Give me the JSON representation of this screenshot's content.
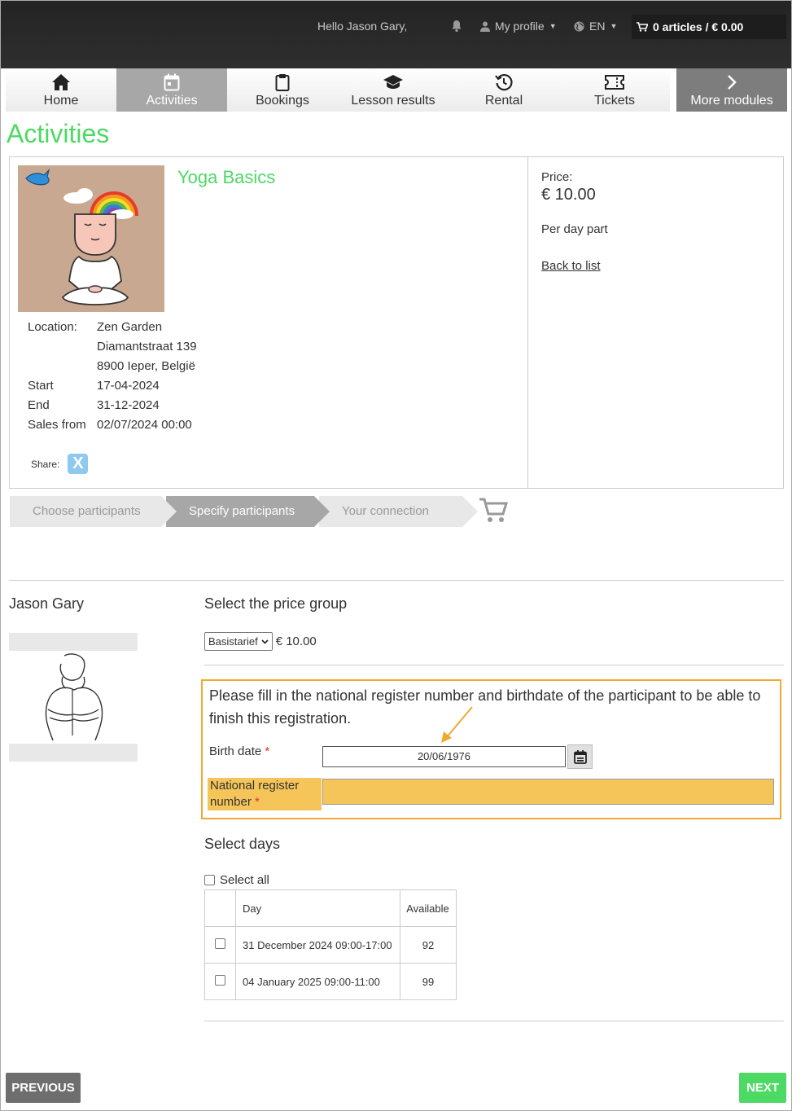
{
  "header": {
    "greeting": "Hello Jason Gary,",
    "profile_label": "My profile",
    "language": "EN",
    "cart_label": "0 articles / € 0.00"
  },
  "nav": {
    "tabs": [
      {
        "label": "Home",
        "icon": "home-icon"
      },
      {
        "label": "Activities",
        "icon": "calendar-icon",
        "active": true
      },
      {
        "label": "Bookings",
        "icon": "clipboard-icon"
      },
      {
        "label": "Lesson results",
        "icon": "graduation-cap-icon"
      },
      {
        "label": "Rental",
        "icon": "history-icon"
      },
      {
        "label": "Tickets",
        "icon": "ticket-icon"
      }
    ],
    "more_label": "More modules"
  },
  "page_title": "Activities",
  "activity": {
    "name": "Yoga Basics",
    "location_label": "Location:",
    "location_name": "Zen Garden",
    "address_line1": "Diamantstraat 139",
    "address_line2": "8900 Ieper, België",
    "start_label": "Start",
    "start": "17-04-2024",
    "end_label": "End",
    "end": "31-12-2024",
    "sales_from_label": "Sales from",
    "sales_from": "02/07/2024 00:00",
    "share_label": "Share:",
    "price_label": "Price:",
    "price": "€ 10.00",
    "price_unit": "Per day part",
    "back_link": "Back to list"
  },
  "steps": {
    "step1": "Choose participants",
    "step2": "Specify participants",
    "step3": "Your connection"
  },
  "participant": {
    "name": "Jason Gary"
  },
  "price_group": {
    "title": "Select the price group",
    "selected": "Basistarief",
    "price": "€ 10.00"
  },
  "warning": {
    "text": "Please fill in the national register number and birthdate of the participant to be able to finish this registration.",
    "birth_label": "Birth date",
    "birth_value": "20/06/1976",
    "nrn_label": "National register number",
    "nrn_value": "",
    "required_mark": "*"
  },
  "days": {
    "title": "Select days",
    "select_all": "Select all",
    "headers": {
      "day": "Day",
      "available": "Available"
    },
    "rows": [
      {
        "day": "31 December 2024 09:00-17:00",
        "available": "92"
      },
      {
        "day": "04 January 2025 09:00-11:00",
        "available": "99"
      }
    ]
  },
  "buttons": {
    "previous": "PREVIOUS",
    "next": "NEXT"
  },
  "colors": {
    "accent_green": "#4cd964",
    "highlight_orange": "#f0a830",
    "field_highlight": "#f6c55a"
  }
}
